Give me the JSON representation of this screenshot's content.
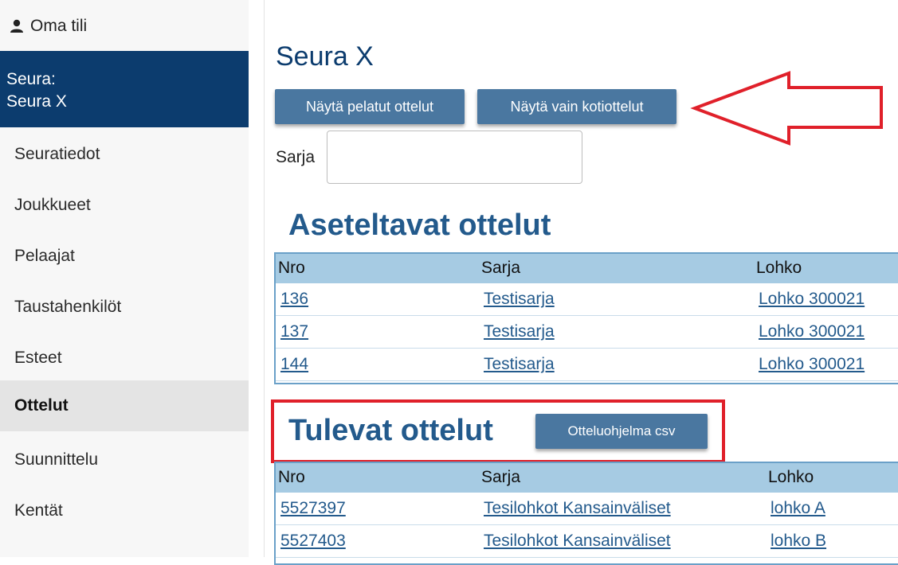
{
  "sidebar": {
    "account_label": "Oma tili",
    "club_heading": "Seura:",
    "club_name": "Seura X",
    "items": [
      {
        "label": "Seuratiedot",
        "active": false
      },
      {
        "label": "Joukkueet",
        "active": false
      },
      {
        "label": "Pelaajat",
        "active": false
      },
      {
        "label": "Taustahenkilöt",
        "active": false
      },
      {
        "label": "Esteet",
        "active": false
      },
      {
        "label": "Ottelut",
        "active": true
      },
      {
        "label": "Suunnittelu",
        "active": false
      },
      {
        "label": "Kentät",
        "active": false
      }
    ]
  },
  "main": {
    "title": "Seura X",
    "buttons": {
      "played": "Näytä pelatut ottelut",
      "home_only": "Näytä vain kotiottelut"
    },
    "filter": {
      "label": "Sarja",
      "value": ""
    },
    "unassigned": {
      "title": "Aseteltavat ottelut",
      "columns": [
        "Nro",
        "Sarja",
        "Lohko"
      ],
      "rows": [
        [
          "136",
          "Testisarja",
          "Lohko 300021"
        ],
        [
          "137",
          "Testisarja",
          "Lohko 300021"
        ],
        [
          "144",
          "Testisarja",
          "Lohko 300021"
        ]
      ]
    },
    "upcoming": {
      "title": "Tulevat ottelut",
      "csv_button": "Otteluohjelma csv",
      "columns": [
        "Nro",
        "Sarja",
        "Lohko"
      ],
      "rows": [
        [
          "5527397",
          "Tesilohkot Kansainväliset",
          "lohko A"
        ],
        [
          "5527403",
          "Tesilohkot Kansainväliset",
          "lohko B"
        ]
      ]
    }
  },
  "colors": {
    "brand_dark": "#0c3c6e",
    "button": "#4a77a0",
    "table_header": "#a6cbe3",
    "link": "#235a8c",
    "annotation": "#e0202a"
  },
  "icons": {
    "account": "person-icon",
    "annotation_arrow": "left-arrow-outline"
  }
}
